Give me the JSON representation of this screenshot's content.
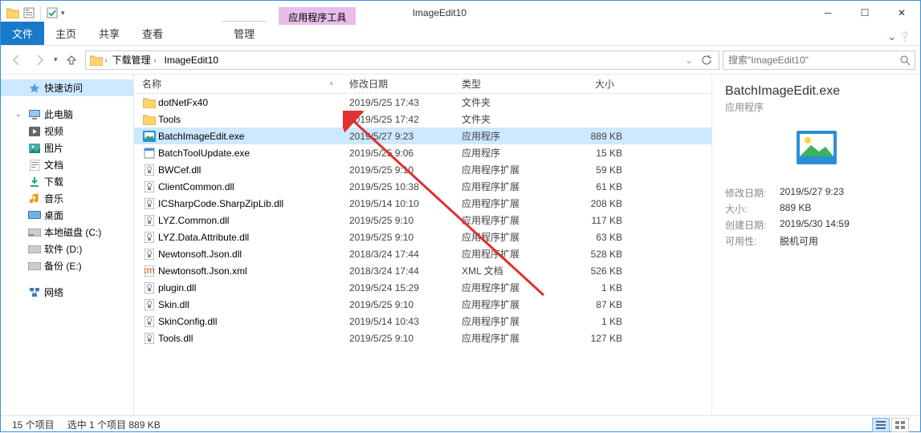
{
  "window": {
    "tooltab": "应用程序工具",
    "title": "ImageEdit10"
  },
  "ribbon": {
    "file": "文件",
    "home": "主页",
    "share": "共享",
    "view": "查看",
    "manage": "管理",
    "help_glyph": "⌄ ❔"
  },
  "nav": {
    "back": "←",
    "fwd": "→",
    "up": "↑"
  },
  "breadcrumb": {
    "items": [
      "下载管理",
      "ImageEdit10"
    ]
  },
  "search": {
    "placeholder": "搜索\"ImageEdit10\""
  },
  "sidebar": {
    "quick": "快速访问",
    "thispc": "此电脑",
    "videos": "视频",
    "pictures": "图片",
    "documents": "文档",
    "downloads": "下载",
    "music": "音乐",
    "desktop": "桌面",
    "localc": "本地磁盘 (C:)",
    "soft": "软件 (D:)",
    "backup": "备份 (E:)",
    "network": "网络"
  },
  "columns": {
    "name": "名称",
    "date": "修改日期",
    "type": "类型",
    "size": "大小"
  },
  "files": [
    {
      "icon": "folder",
      "name": "dotNetFx40",
      "date": "2019/5/25 17:43",
      "type": "文件夹",
      "size": ""
    },
    {
      "icon": "folder",
      "name": "Tools",
      "date": "2019/5/25 17:42",
      "type": "文件夹",
      "size": ""
    },
    {
      "icon": "exe-app",
      "name": "BatchImageEdit.exe",
      "date": "2019/5/27 9:23",
      "type": "应用程序",
      "size": "889 KB",
      "selected": true
    },
    {
      "icon": "exe",
      "name": "BatchToolUpdate.exe",
      "date": "2019/5/25 9:06",
      "type": "应用程序",
      "size": "15 KB"
    },
    {
      "icon": "dll",
      "name": "BWCef.dll",
      "date": "2019/5/25 9:10",
      "type": "应用程序扩展",
      "size": "59 KB"
    },
    {
      "icon": "dll",
      "name": "ClientCommon.dll",
      "date": "2019/5/25 10:38",
      "type": "应用程序扩展",
      "size": "61 KB"
    },
    {
      "icon": "dll",
      "name": "ICSharpCode.SharpZipLib.dll",
      "date": "2019/5/14 10:10",
      "type": "应用程序扩展",
      "size": "208 KB"
    },
    {
      "icon": "dll",
      "name": "LYZ.Common.dll",
      "date": "2019/5/25 9:10",
      "type": "应用程序扩展",
      "size": "117 KB"
    },
    {
      "icon": "dll",
      "name": "LYZ.Data.Attribute.dll",
      "date": "2019/5/25 9:10",
      "type": "应用程序扩展",
      "size": "63 KB"
    },
    {
      "icon": "dll",
      "name": "Newtonsoft.Json.dll",
      "date": "2018/3/24 17:44",
      "type": "应用程序扩展",
      "size": "528 KB"
    },
    {
      "icon": "xml",
      "name": "Newtonsoft.Json.xml",
      "date": "2018/3/24 17:44",
      "type": "XML 文档",
      "size": "526 KB"
    },
    {
      "icon": "dll",
      "name": "plugin.dll",
      "date": "2019/5/24 15:29",
      "type": "应用程序扩展",
      "size": "1 KB"
    },
    {
      "icon": "dll",
      "name": "Skin.dll",
      "date": "2019/5/25 9:10",
      "type": "应用程序扩展",
      "size": "87 KB"
    },
    {
      "icon": "dll",
      "name": "SkinConfig.dll",
      "date": "2019/5/14 10:43",
      "type": "应用程序扩展",
      "size": "1 KB"
    },
    {
      "icon": "dll",
      "name": "Tools.dll",
      "date": "2019/5/25 9:10",
      "type": "应用程序扩展",
      "size": "127 KB"
    }
  ],
  "details": {
    "title": "BatchImageEdit.exe",
    "subtype": "应用程序",
    "props": [
      {
        "k": "修改日期:",
        "v": "2019/5/27 9:23"
      },
      {
        "k": "大小:",
        "v": "889 KB"
      },
      {
        "k": "创建日期:",
        "v": "2019/5/30 14:59"
      },
      {
        "k": "可用性:",
        "v": "脱机可用"
      }
    ]
  },
  "status": {
    "count": "15 个项目",
    "sel": "选中 1 个项目  889 KB"
  }
}
